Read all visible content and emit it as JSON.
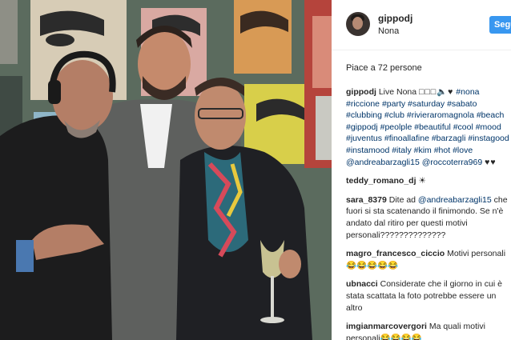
{
  "post": {
    "username": "gippodj",
    "location": "Nona",
    "follow_label": "Segui",
    "likes_text": "Piace a 72 persone"
  },
  "caption": {
    "username": "gippodj",
    "text_start": "Live Nona ",
    "emoji": "□□□🔈♥",
    "hashtags": "#nona #riccione #party #saturday #sabato #clubbing #club #rivieraromagnola #beach #gippodj #peolple #beautiful #cool #mood #juventus #finoallafine #barzagli #instagood #instamood #italy #kim #hot #love",
    "mentions": "@andreabarzagli15 @roccoterra969",
    "end_hearts": "♥♥"
  },
  "comments": [
    {
      "user": "teddy_romano_dj",
      "text": "☀"
    },
    {
      "user": "sara_8379",
      "text_pre": "Dite ad ",
      "mention": "@andreabarzagli15",
      "text_post": " che fuori si sta scatenando il finimondo. Se n'è andato dal ritiro per questi motivi personali??????????????"
    },
    {
      "user": "magro_francesco_ciccio",
      "text": "Motivi personali😂😂😂😂😂"
    },
    {
      "user": "ubnacci",
      "text": "Considerate che il giorno in cui è stata scattata la foto potrebbe essere un altro"
    },
    {
      "user": "imgianmarcovergori",
      "text": "Ma quali motivi personali😂😂😂😂"
    }
  ],
  "colors": {
    "accent": "#3897f0",
    "hashtag": "#003569",
    "text": "#262626"
  }
}
